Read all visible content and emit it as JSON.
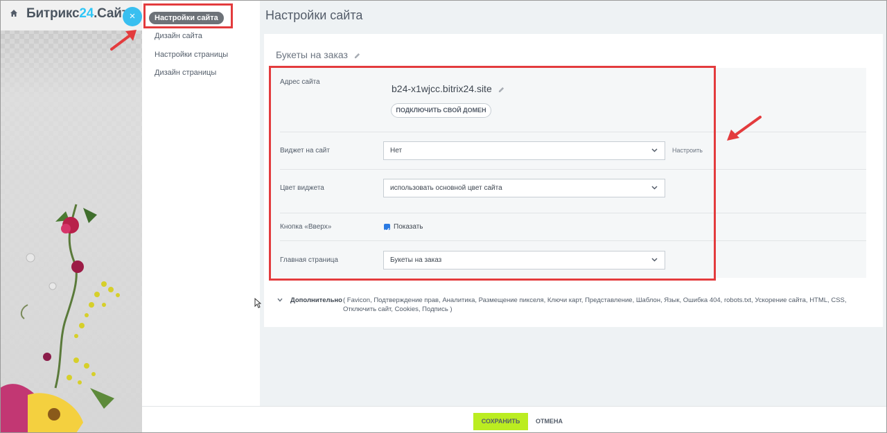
{
  "header": {
    "logo_part1": "Битрикс",
    "logo_part2": "24",
    "logo_part3": ".Сайты",
    "close_label": "×"
  },
  "sidebar": {
    "items": [
      {
        "label": "Настройки сайта",
        "active": true
      },
      {
        "label": "Дизайн сайта"
      },
      {
        "label": "Настройки страницы"
      },
      {
        "label": "Дизайн страницы"
      }
    ]
  },
  "main": {
    "page_title": "Настройки сайта",
    "site_title": "Букеты на заказ",
    "address": {
      "label": "Адрес сайта",
      "value": "b24-x1wjcc.bitrix24.site",
      "domain_button": "ПОДКЛЮЧИТЬ СВОЙ ДОМЕН"
    },
    "widget": {
      "label": "Виджет на сайт",
      "value": "Нет",
      "configure": "Настроить"
    },
    "widget_color": {
      "label": "Цвет виджета",
      "value": "использовать основной цвет сайта"
    },
    "up_button": {
      "label": "Кнопка «Вверх»",
      "checked": true,
      "check_label": "Показать"
    },
    "home_page": {
      "label": "Главная страница",
      "value": "Букеты на заказ"
    },
    "more": {
      "label": "Дополнительно",
      "links": "( Favicon,  Подтверждение прав,  Аналитика,  Размещение пикселя,  Ключи карт,  Представление,  Шаблон,  Язык,  Ошибка 404,  robots.txt,  Ускорение сайта,  HTML,  CSS,  Отключить сайт,  Cookies,  Подпись )"
    }
  },
  "footer": {
    "save": "СОХРАНИТЬ",
    "cancel": "ОТМЕНА"
  },
  "colors": {
    "accent": "#2fc6f6",
    "highlight": "#e33b3d",
    "save": "#bbed21",
    "nav_active": "#6d7278"
  }
}
